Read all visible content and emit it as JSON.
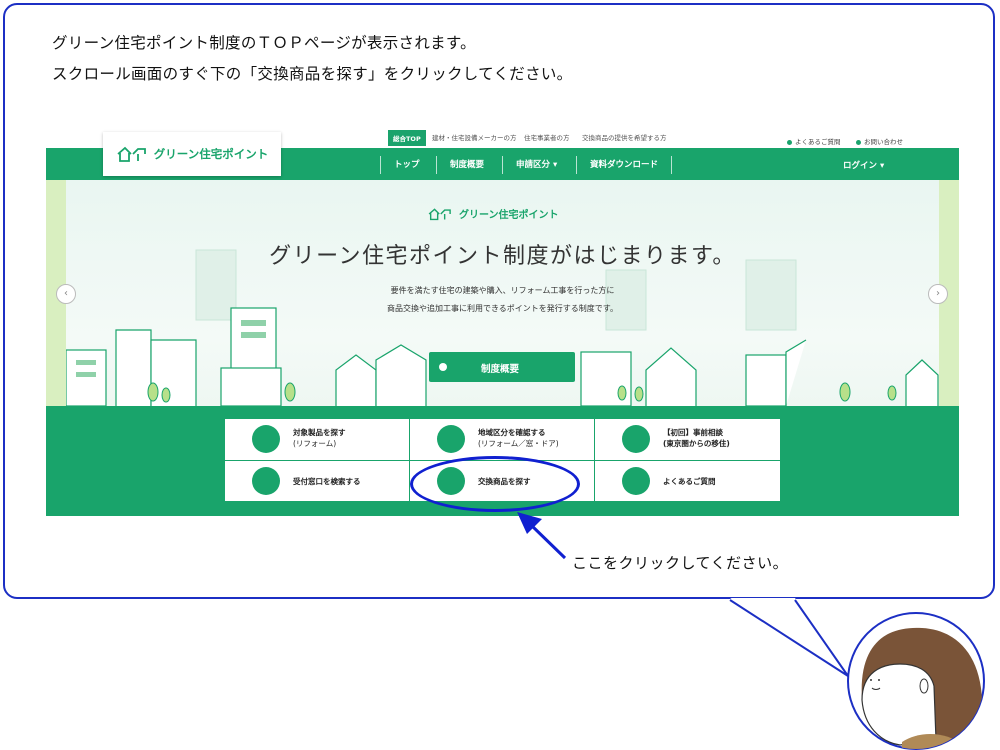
{
  "instructions": {
    "line1": "グリーン住宅ポイント制度のＴＯＰページが表示されます。",
    "line2": "スクロール画面のすぐ下の「交換商品を探す」をクリックしてください。"
  },
  "site": {
    "logo_text": "グリーン住宅ポイント",
    "top_tabs": [
      "総合TOP",
      "建材・住宅設備メーカーの方",
      "住宅事業者の方",
      "交換商品の提供を希望する方"
    ],
    "utility_links": [
      "よくあるご質問",
      "お問い合わせ"
    ],
    "nav": [
      "トップ",
      "制度概要",
      "申請区分 ▾",
      "資料ダウンロード"
    ],
    "login": "ログイン ▾",
    "hero": {
      "logo_text": "グリーン住宅ポイント",
      "title": "グリーン住宅ポイント制度がはじまります。",
      "sub1": "要件を満たす住宅の建築や購入、リフォーム工事を行った方に",
      "sub2": "商品交換や追加工事に利用できるポイントを発行する制度です。",
      "button": "制度概要"
    },
    "links": [
      {
        "line1": "対象製品を探す",
        "line2": "(リフォーム)"
      },
      {
        "line1": "地域区分を確認する",
        "line2": "(リフォーム／窓・ドア)"
      },
      {
        "line1": "【初回】事前相談",
        "line2": "(東京圏からの移住)"
      },
      {
        "line1": "受付窓口を検索する",
        "line2": ""
      },
      {
        "line1": "交換商品を探す",
        "line2": ""
      },
      {
        "line1": "よくあるご質問",
        "line2": ""
      }
    ]
  },
  "callout": "ここをクリックしてください。",
  "colors": {
    "brand_green": "#19a46b",
    "highlight_blue": "#1020d0"
  }
}
